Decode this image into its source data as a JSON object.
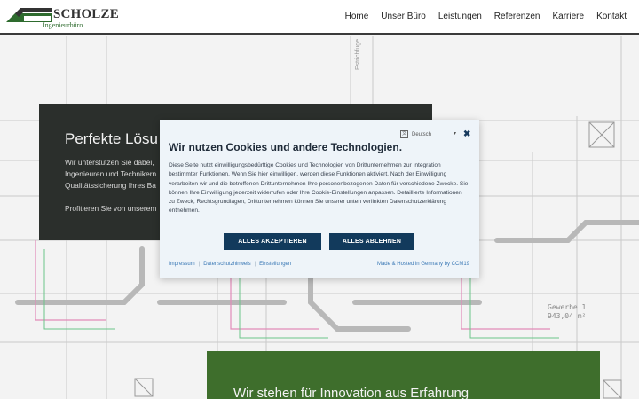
{
  "header": {
    "logo_name": "SCHOLZE",
    "logo_sub": "Ingenieurbüro",
    "nav": [
      "Home",
      "Unser Büro",
      "Leistungen",
      "Referenzen",
      "Karriere",
      "Kontakt"
    ]
  },
  "hero": {
    "title": "Perfekte Lösu",
    "text": "Wir unterstützen Sie dabei, Ingenieuren und Technikern Qualitätssicherung Ihres Ba",
    "cta": "Profitieren Sie von unserem"
  },
  "green": {
    "title": "Wir stehen für Innovation aus Erfahrung"
  },
  "cookie": {
    "language": "Deutsch",
    "title": "Wir nutzen Cookies und andere Technologien.",
    "text": "Diese Seite nutzt einwilligungsbedürftige Cookies und Technologien von Drittunternehmen zur Integration bestimmter Funktionen. Wenn Sie hier einwilligen, werden diese Funktionen aktiviert. Nach der Einwilligung verarbeiten wir und die betroffenen Drittunternehmen Ihre personenbezogenen Daten für verschiedene Zwecke. Sie können Ihre Einwilligung jederzeit widerrufen oder Ihre Cookie-Einstellungen anpassen. Detaillierte Informationen zu Zweck, Rechtsgrundlagen, Drittunternehmen können Sie unserer unten verlinkten Datenschutzerklärung entnehmen.",
    "accept_label": "ALLES AKZEPTIEREN",
    "reject_label": "ALLES ABLEHNEN",
    "links": [
      "Impressum",
      "Datenschutzhinweis",
      "Einstellungen"
    ],
    "hosted": "Made & Hosted in Germany by CCM19"
  },
  "blueprint": {
    "labels": [
      "Estrichfuge",
      "Gewerbe 1",
      "943,04 m²"
    ]
  },
  "colors": {
    "header_border": "#3a3a3a",
    "hero_bg": "#2b2f2c",
    "green_bg": "#3e6e2c",
    "cookie_bg": "#eef4f9",
    "button_bg": "#123a5c",
    "link": "#3a78b5"
  }
}
